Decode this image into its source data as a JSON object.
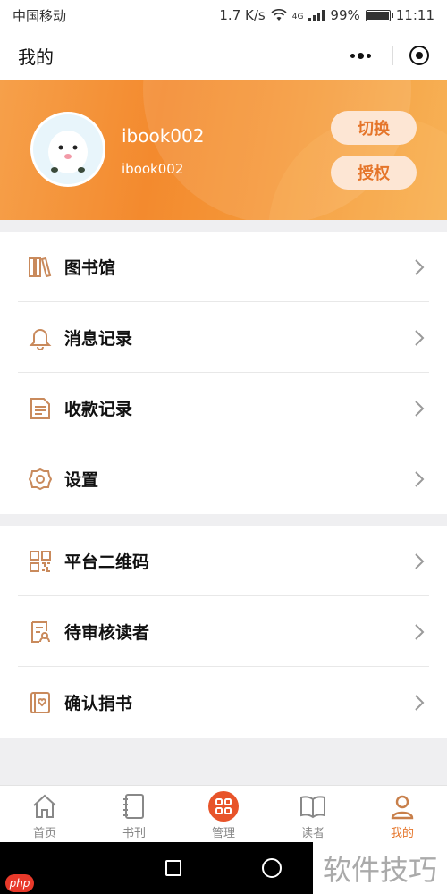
{
  "status_bar": {
    "carrier": "中国移动",
    "speed": "1.7 K/s",
    "network": "4G",
    "battery": "99%",
    "time": "11:11"
  },
  "title_bar": {
    "title": "我的"
  },
  "profile": {
    "username": "ibook002",
    "user_id": "ibook002",
    "switch_label": "切换",
    "auth_label": "授权"
  },
  "menu_group1": [
    {
      "label": "图书馆",
      "icon": "books-icon"
    },
    {
      "label": "消息记录",
      "icon": "bell-icon"
    },
    {
      "label": "收款记录",
      "icon": "document-icon"
    },
    {
      "label": "设置",
      "icon": "gear-icon"
    }
  ],
  "menu_group2": [
    {
      "label": "平台二维码",
      "icon": "qr-code-icon"
    },
    {
      "label": "待审核读者",
      "icon": "review-icon"
    },
    {
      "label": "确认捐书",
      "icon": "donate-book-icon"
    }
  ],
  "tabs": [
    {
      "label": "首页",
      "icon": "home-icon"
    },
    {
      "label": "书刊",
      "icon": "notebook-icon"
    },
    {
      "label": "管理",
      "icon": "manage-icon"
    },
    {
      "label": "读者",
      "icon": "reader-book-icon"
    },
    {
      "label": "我的",
      "icon": "profile-icon",
      "active": true
    }
  ],
  "watermark": {
    "text": "软件技巧",
    "badge": "php"
  },
  "colors": {
    "accent": "#e5752a",
    "banner": "#f38a2e",
    "manage": "#e8542a"
  }
}
